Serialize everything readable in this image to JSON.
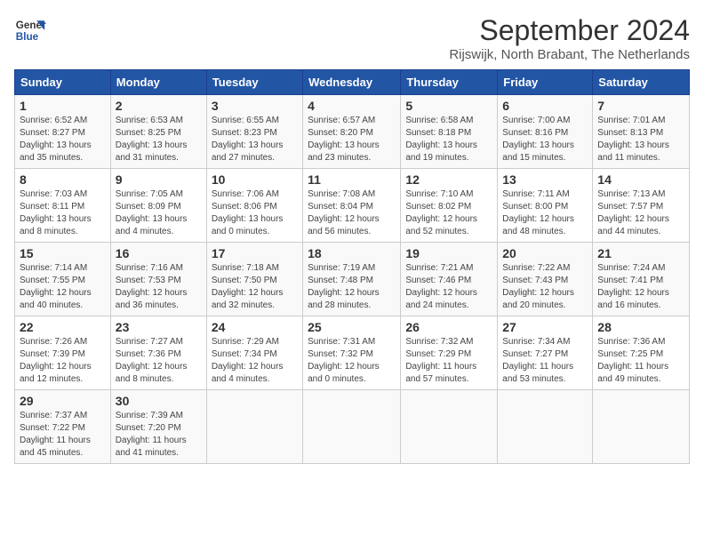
{
  "logo": {
    "line1": "General",
    "line2": "Blue"
  },
  "title": "September 2024",
  "subtitle": "Rijswijk, North Brabant, The Netherlands",
  "days_header": [
    "Sunday",
    "Monday",
    "Tuesday",
    "Wednesday",
    "Thursday",
    "Friday",
    "Saturday"
  ],
  "weeks": [
    [
      {
        "day": "1",
        "detail": "Sunrise: 6:52 AM\nSunset: 8:27 PM\nDaylight: 13 hours\nand 35 minutes."
      },
      {
        "day": "2",
        "detail": "Sunrise: 6:53 AM\nSunset: 8:25 PM\nDaylight: 13 hours\nand 31 minutes."
      },
      {
        "day": "3",
        "detail": "Sunrise: 6:55 AM\nSunset: 8:23 PM\nDaylight: 13 hours\nand 27 minutes."
      },
      {
        "day": "4",
        "detail": "Sunrise: 6:57 AM\nSunset: 8:20 PM\nDaylight: 13 hours\nand 23 minutes."
      },
      {
        "day": "5",
        "detail": "Sunrise: 6:58 AM\nSunset: 8:18 PM\nDaylight: 13 hours\nand 19 minutes."
      },
      {
        "day": "6",
        "detail": "Sunrise: 7:00 AM\nSunset: 8:16 PM\nDaylight: 13 hours\nand 15 minutes."
      },
      {
        "day": "7",
        "detail": "Sunrise: 7:01 AM\nSunset: 8:13 PM\nDaylight: 13 hours\nand 11 minutes."
      }
    ],
    [
      {
        "day": "8",
        "detail": "Sunrise: 7:03 AM\nSunset: 8:11 PM\nDaylight: 13 hours\nand 8 minutes."
      },
      {
        "day": "9",
        "detail": "Sunrise: 7:05 AM\nSunset: 8:09 PM\nDaylight: 13 hours\nand 4 minutes."
      },
      {
        "day": "10",
        "detail": "Sunrise: 7:06 AM\nSunset: 8:06 PM\nDaylight: 13 hours\nand 0 minutes."
      },
      {
        "day": "11",
        "detail": "Sunrise: 7:08 AM\nSunset: 8:04 PM\nDaylight: 12 hours\nand 56 minutes."
      },
      {
        "day": "12",
        "detail": "Sunrise: 7:10 AM\nSunset: 8:02 PM\nDaylight: 12 hours\nand 52 minutes."
      },
      {
        "day": "13",
        "detail": "Sunrise: 7:11 AM\nSunset: 8:00 PM\nDaylight: 12 hours\nand 48 minutes."
      },
      {
        "day": "14",
        "detail": "Sunrise: 7:13 AM\nSunset: 7:57 PM\nDaylight: 12 hours\nand 44 minutes."
      }
    ],
    [
      {
        "day": "15",
        "detail": "Sunrise: 7:14 AM\nSunset: 7:55 PM\nDaylight: 12 hours\nand 40 minutes."
      },
      {
        "day": "16",
        "detail": "Sunrise: 7:16 AM\nSunset: 7:53 PM\nDaylight: 12 hours\nand 36 minutes."
      },
      {
        "day": "17",
        "detail": "Sunrise: 7:18 AM\nSunset: 7:50 PM\nDaylight: 12 hours\nand 32 minutes."
      },
      {
        "day": "18",
        "detail": "Sunrise: 7:19 AM\nSunset: 7:48 PM\nDaylight: 12 hours\nand 28 minutes."
      },
      {
        "day": "19",
        "detail": "Sunrise: 7:21 AM\nSunset: 7:46 PM\nDaylight: 12 hours\nand 24 minutes."
      },
      {
        "day": "20",
        "detail": "Sunrise: 7:22 AM\nSunset: 7:43 PM\nDaylight: 12 hours\nand 20 minutes."
      },
      {
        "day": "21",
        "detail": "Sunrise: 7:24 AM\nSunset: 7:41 PM\nDaylight: 12 hours\nand 16 minutes."
      }
    ],
    [
      {
        "day": "22",
        "detail": "Sunrise: 7:26 AM\nSunset: 7:39 PM\nDaylight: 12 hours\nand 12 minutes."
      },
      {
        "day": "23",
        "detail": "Sunrise: 7:27 AM\nSunset: 7:36 PM\nDaylight: 12 hours\nand 8 minutes."
      },
      {
        "day": "24",
        "detail": "Sunrise: 7:29 AM\nSunset: 7:34 PM\nDaylight: 12 hours\nand 4 minutes."
      },
      {
        "day": "25",
        "detail": "Sunrise: 7:31 AM\nSunset: 7:32 PM\nDaylight: 12 hours\nand 0 minutes."
      },
      {
        "day": "26",
        "detail": "Sunrise: 7:32 AM\nSunset: 7:29 PM\nDaylight: 11 hours\nand 57 minutes."
      },
      {
        "day": "27",
        "detail": "Sunrise: 7:34 AM\nSunset: 7:27 PM\nDaylight: 11 hours\nand 53 minutes."
      },
      {
        "day": "28",
        "detail": "Sunrise: 7:36 AM\nSunset: 7:25 PM\nDaylight: 11 hours\nand 49 minutes."
      }
    ],
    [
      {
        "day": "29",
        "detail": "Sunrise: 7:37 AM\nSunset: 7:22 PM\nDaylight: 11 hours\nand 45 minutes."
      },
      {
        "day": "30",
        "detail": "Sunrise: 7:39 AM\nSunset: 7:20 PM\nDaylight: 11 hours\nand 41 minutes."
      },
      {
        "day": "",
        "detail": ""
      },
      {
        "day": "",
        "detail": ""
      },
      {
        "day": "",
        "detail": ""
      },
      {
        "day": "",
        "detail": ""
      },
      {
        "day": "",
        "detail": ""
      }
    ]
  ]
}
